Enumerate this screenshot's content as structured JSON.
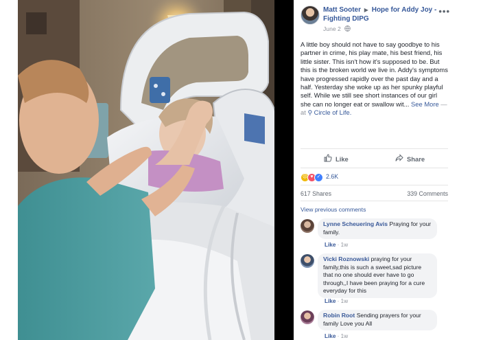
{
  "post": {
    "author": "Matt Sooter",
    "page": "Hope for Addy Joy - Fighting DIPG",
    "date": "June 2",
    "more": "•••",
    "text": "A little boy should not have to say goodbye to his partner in crime, his play mate, his best friend, his little sister. This isn't how it's supposed to be. But this is the broken world we live in. Addy's symptoms have progressed rapidly over the past day and a half. Yesterday she woke up as her spunky playful self. While we still see short instances of our girl she can no longer eat or swallow wit...",
    "see_more": "See More",
    "at": "— at",
    "place": "Circle of Life."
  },
  "actions": {
    "like": "Like",
    "share": "Share"
  },
  "reactions": {
    "count": "2.6K"
  },
  "counts": {
    "shares": "617 Shares",
    "comments": "339 Comments"
  },
  "view_previous": "View previous comments",
  "comments": [
    {
      "name": "Lynne Scheuering Avis",
      "text": "Praying for your family.",
      "like": "Like",
      "time": "1w"
    },
    {
      "name": "Vicki Roznowski",
      "text": "praying for your family,this is such a sweet,sad picture that no one should ever have to go through,,I have been praying for a cure everyday for this",
      "like": "Like",
      "time": "1w"
    },
    {
      "name": "Robin Root",
      "text": "Sending prayers for your family Love you All",
      "like": "Like",
      "time": "1w"
    }
  ],
  "colors": {
    "link": "#365899",
    "bubble": "#f2f3f5",
    "meta": "#90949c"
  },
  "icons": [
    "globe-icon",
    "more-icon",
    "like-icon",
    "share-icon",
    "location-pin-icon",
    "sad-reaction-icon",
    "love-reaction-icon",
    "like-reaction-icon"
  ]
}
